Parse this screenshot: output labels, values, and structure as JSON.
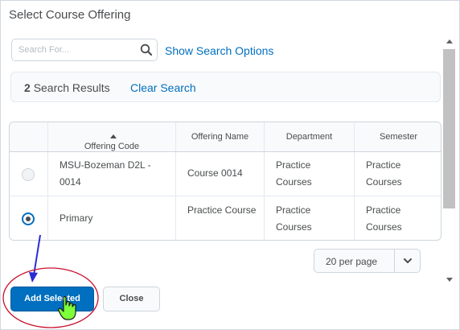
{
  "dialog": {
    "title": "Select Course Offering"
  },
  "search": {
    "placeholder": "Search For...",
    "value": "",
    "show_options_label": "Show Search Options"
  },
  "results": {
    "count": "2",
    "count_label": "Search Results",
    "clear_label": "Clear Search"
  },
  "table": {
    "headers": [
      "Offering Code",
      "Offering Name",
      "Department",
      "Semester"
    ],
    "rows": [
      {
        "selected": false,
        "code": "MSU-Bozeman D2L - 0014",
        "name": "Course 0014",
        "department": "Practice Courses",
        "semester": "Practice Courses"
      },
      {
        "selected": true,
        "code": "Primary",
        "name": "Practice Course",
        "department": "Practice Courses",
        "semester": "Practice Courses"
      }
    ]
  },
  "pager": {
    "label": "20 per page"
  },
  "buttons": {
    "add_selected": "Add Selected",
    "close": "Close"
  },
  "colors": {
    "accent": "#006fbf",
    "annotation_circle": "#c8102e",
    "annotation_arrow": "#2b2bd6",
    "cursor": "#7dff3a"
  }
}
